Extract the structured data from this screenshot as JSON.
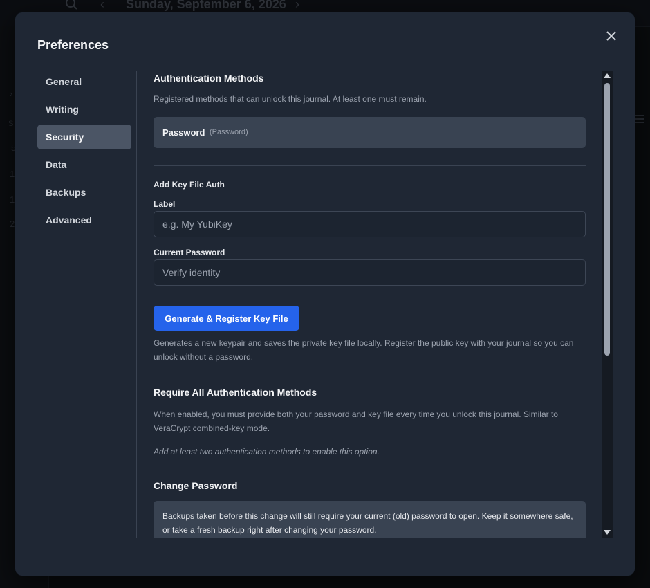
{
  "background": {
    "date": "Sunday, September 6, 2026",
    "sidebar_fragments": [
      "S",
      "5",
      "1",
      "1",
      "2"
    ]
  },
  "modal": {
    "title": "Preferences",
    "nav": [
      {
        "label": "General"
      },
      {
        "label": "Writing"
      },
      {
        "label": "Security",
        "active": true
      },
      {
        "label": "Data"
      },
      {
        "label": "Backups"
      },
      {
        "label": "Advanced"
      }
    ],
    "auth_methods": {
      "heading": "Authentication Methods",
      "description": "Registered methods that can unlock this journal. At least one must remain.",
      "methods": [
        {
          "name": "Password",
          "type": "(Password)"
        }
      ]
    },
    "key_file": {
      "heading": "Add Key File Auth",
      "label_field": {
        "label": "Label",
        "placeholder": "e.g. My YubiKey",
        "value": ""
      },
      "password_field": {
        "label": "Current Password",
        "placeholder": "Verify identity",
        "value": ""
      },
      "button_label": "Generate & Register Key File",
      "note": "Generates a new keypair and saves the private key file locally. Register the public key with your journal so you can unlock without a password."
    },
    "require_all": {
      "heading": "Require All Authentication Methods",
      "description": "When enabled, you must provide both your password and key file every time you unlock this journal. Similar to VeraCrypt combined-key mode.",
      "hint": "Add at least two authentication methods to enable this option."
    },
    "change_password": {
      "heading": "Change Password",
      "warning": "Backups taken before this change will still require your current (old) password to open. Keep it somewhere safe, or take a fresh backup right after changing your password."
    }
  },
  "colors": {
    "accent": "#2563eb",
    "modal_bg": "#1f2734",
    "panel_bg": "#394352"
  }
}
